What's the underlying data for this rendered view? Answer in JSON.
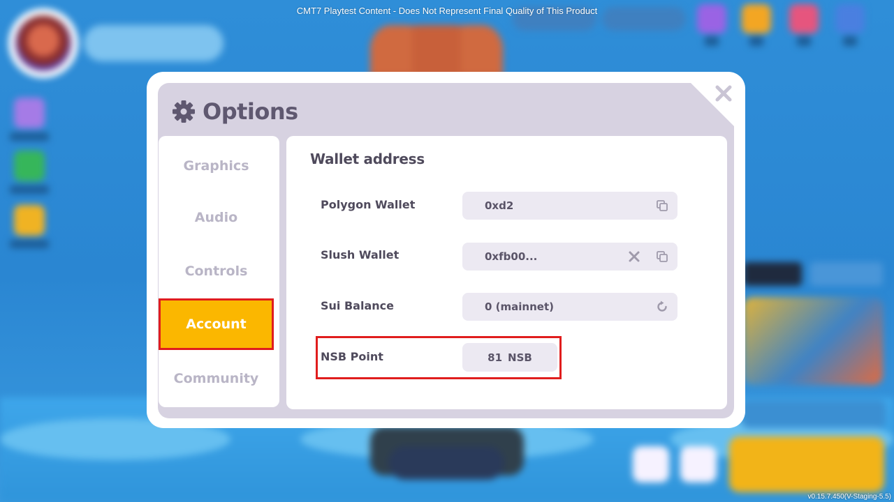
{
  "banner": "CMT7 Playtest Content - Does Not Represent Final Quality of This Product",
  "version": "v0.15.7.450(V-Staging-5.5)",
  "options": {
    "title": "Options",
    "tabs": [
      {
        "label": "Graphics",
        "active": false
      },
      {
        "label": "Audio",
        "active": false
      },
      {
        "label": "Controls",
        "active": false
      },
      {
        "label": "Account",
        "active": true
      },
      {
        "label": "Community",
        "active": false
      }
    ],
    "section_title": "Wallet address",
    "rows": {
      "polygon": {
        "label": "Polygon Wallet",
        "value": "0xd2"
      },
      "slush": {
        "label": "Slush Wallet",
        "value": "0xfb00..."
      },
      "sui": {
        "label": "Sui Balance",
        "value": "0 (mainnet)"
      },
      "nsb": {
        "label": "NSB Point",
        "amount": "81",
        "unit": "NSB"
      }
    }
  },
  "colors": {
    "accent": "#fbb700",
    "highlight": "#e01d1d",
    "panel_bg": "#d7d2e1",
    "text": "#4f4a5c"
  },
  "icons": [
    "gear-icon",
    "close-icon",
    "copy-icon",
    "clear-icon",
    "refresh-icon"
  ]
}
